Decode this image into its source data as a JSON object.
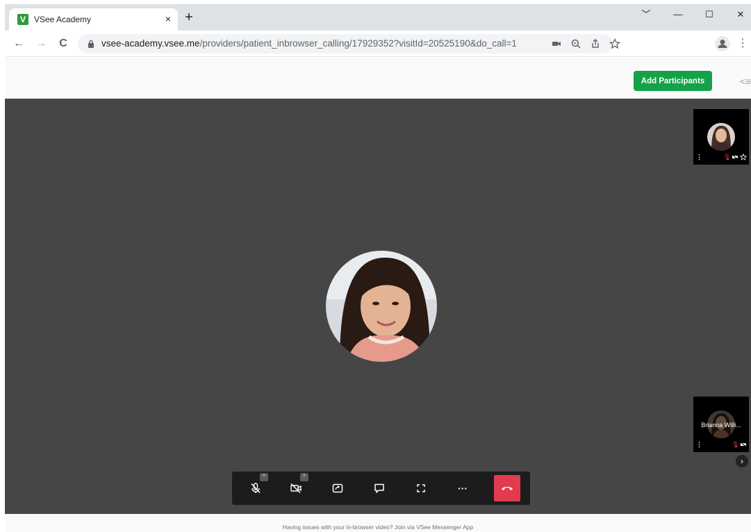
{
  "browser": {
    "tab": {
      "title": "VSee Academy",
      "favicon_letter": "V",
      "close_glyph": "×"
    },
    "new_tab_glyph": "+",
    "window_controls": [
      "﹀",
      "—",
      "☐",
      "✕"
    ],
    "nav": {
      "back": "←",
      "forward": "→",
      "reload": "C"
    },
    "url": {
      "host": "vsee-academy.vsee.me",
      "path": "/providers/patient_inbrowser_calling/17929352?visitId=20525190&do_call=1"
    },
    "omnibox_icons": [
      "camera-icon",
      "zoom-icon",
      "share-icon",
      "star-icon"
    ],
    "menu_glyph": "⋮"
  },
  "header": {
    "add_participants_label": "Add Participants",
    "collapse_glyph": "<≡"
  },
  "participants": [
    {
      "name": "",
      "mic": "muted",
      "video": "off",
      "starred": true
    },
    {
      "name": "Brianna Willi...",
      "mic": "muted",
      "video": "off"
    }
  ],
  "controls": {
    "items": [
      "mic-muted-icon",
      "camera-off-icon",
      "screen-share-icon",
      "chat-icon",
      "fullscreen-icon",
      "more-icon",
      "hangup-icon"
    ],
    "more_glyph": "···"
  },
  "footer": {
    "text": "Having issues with your in-browser video? Join via VSee Messenger App"
  },
  "colors": {
    "accent_green": "#14a14a",
    "hangup_red": "#e23b4e",
    "stage_bg": "#464646"
  }
}
